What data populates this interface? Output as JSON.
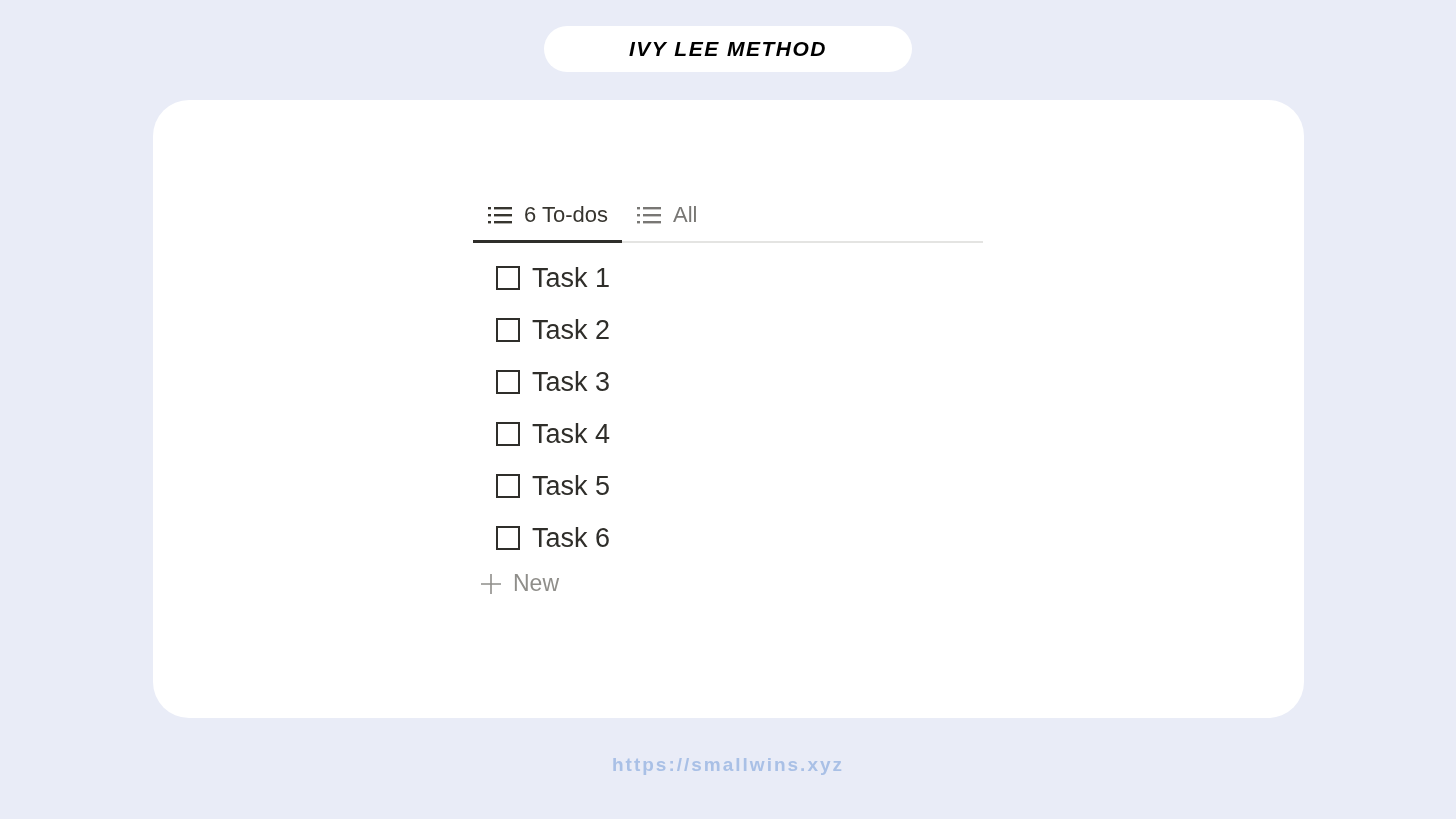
{
  "title": "IVY LEE METHOD",
  "tabs": [
    {
      "label": "6 To-dos",
      "selected": true
    },
    {
      "label": "All",
      "selected": false
    }
  ],
  "tasks": [
    {
      "label": "Task 1",
      "checked": false
    },
    {
      "label": "Task 2",
      "checked": false
    },
    {
      "label": "Task 3",
      "checked": false
    },
    {
      "label": "Task 4",
      "checked": false
    },
    {
      "label": "Task 5",
      "checked": false
    },
    {
      "label": "Task 6",
      "checked": false
    }
  ],
  "new_label": "New",
  "footer_url": "https://smallwins.xyz"
}
